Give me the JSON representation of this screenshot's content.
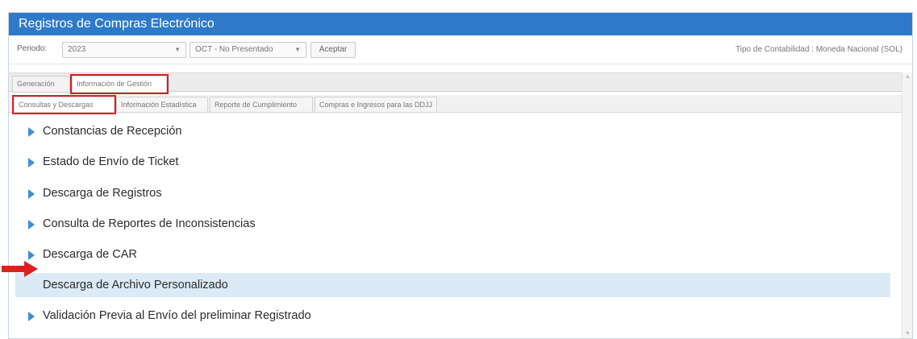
{
  "window": {
    "title": "Registros de Compras Electrónico"
  },
  "toolbar": {
    "periodo_label": "Periodo:",
    "year_value": "2023",
    "periodo_value": "OCT - No Presentado",
    "aceptar_label": "Aceptar",
    "tipo_contabilidad": "Tipo de Contabilidad : Moneda Nacional (SOL)"
  },
  "tabs_main": [
    {
      "label": "Generación"
    },
    {
      "label": "Información de Gestión"
    }
  ],
  "tabs_sub": [
    {
      "label": "Consultas y Descargas"
    },
    {
      "label": "Información Estadística"
    },
    {
      "label": "Reporte de Cumplimiento"
    },
    {
      "label": "Compras e Ingresos para las DDJJ"
    }
  ],
  "items": [
    {
      "label": "Constancias de Recepción"
    },
    {
      "label": "Estado de Envío  de Ticket"
    },
    {
      "label": "Descarga de Registros"
    },
    {
      "label": "Consulta de Reportes de  Inconsistencias"
    },
    {
      "label": "Descarga de CAR"
    },
    {
      "label": "Descarga de Archivo Personalizado"
    },
    {
      "label": "Validación Previa al Envío del preliminar Registrado"
    }
  ],
  "colors": {
    "title_bar": "#2f7ac8",
    "highlight_border": "#d12424",
    "active_row": "#dbeaf5",
    "bullet": "#3d8fd8"
  }
}
